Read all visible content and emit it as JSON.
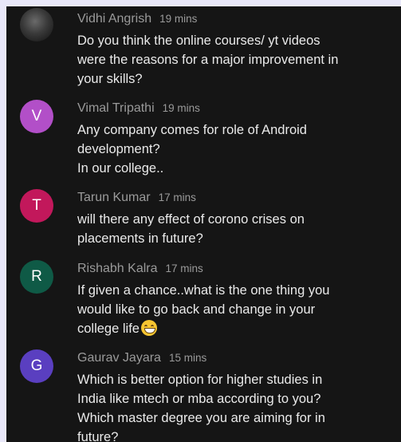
{
  "comments": [
    {
      "author": "Vidhi Angrish",
      "time": "19 mins",
      "avatar": {
        "type": "photo",
        "icon": "user-photo-avatar",
        "color": "#3a3a3a"
      },
      "lines": [
        "Do you think the online courses/ yt videos",
        "were the reasons for a major improvement in",
        "your skills?"
      ]
    },
    {
      "author": "Vimal Tripathi",
      "time": "19 mins",
      "avatar": {
        "type": "letter",
        "letter": "V",
        "color": "#b24fc8"
      },
      "lines": [
        "Any company comes for role of Android",
        "development?",
        "In our college.."
      ]
    },
    {
      "author": "Tarun Kumar",
      "time": "17 mins",
      "avatar": {
        "type": "letter",
        "letter": "T",
        "color": "#c2185b"
      },
      "lines": [
        "will there  any effect of corono crises  on",
        "placements in future?"
      ]
    },
    {
      "author": "Rishabh Kalra",
      "time": "17 mins",
      "avatar": {
        "type": "letter",
        "letter": "R",
        "color": "#0f5a46"
      },
      "lines": [
        "If given a chance..what is the one thing you",
        "would like to go back and change in your",
        "college life"
      ],
      "trailing_emoji": "grinning-face-emoji"
    },
    {
      "author": "Gaurav Jayara",
      "time": "15 mins",
      "avatar": {
        "type": "letter",
        "letter": "G",
        "color": "#5a3fc0"
      },
      "lines": [
        "Which is better option for higher studies in",
        "India like mtech or mba according to you?",
        "Which master degree you are aiming for in",
        "future?"
      ]
    }
  ]
}
